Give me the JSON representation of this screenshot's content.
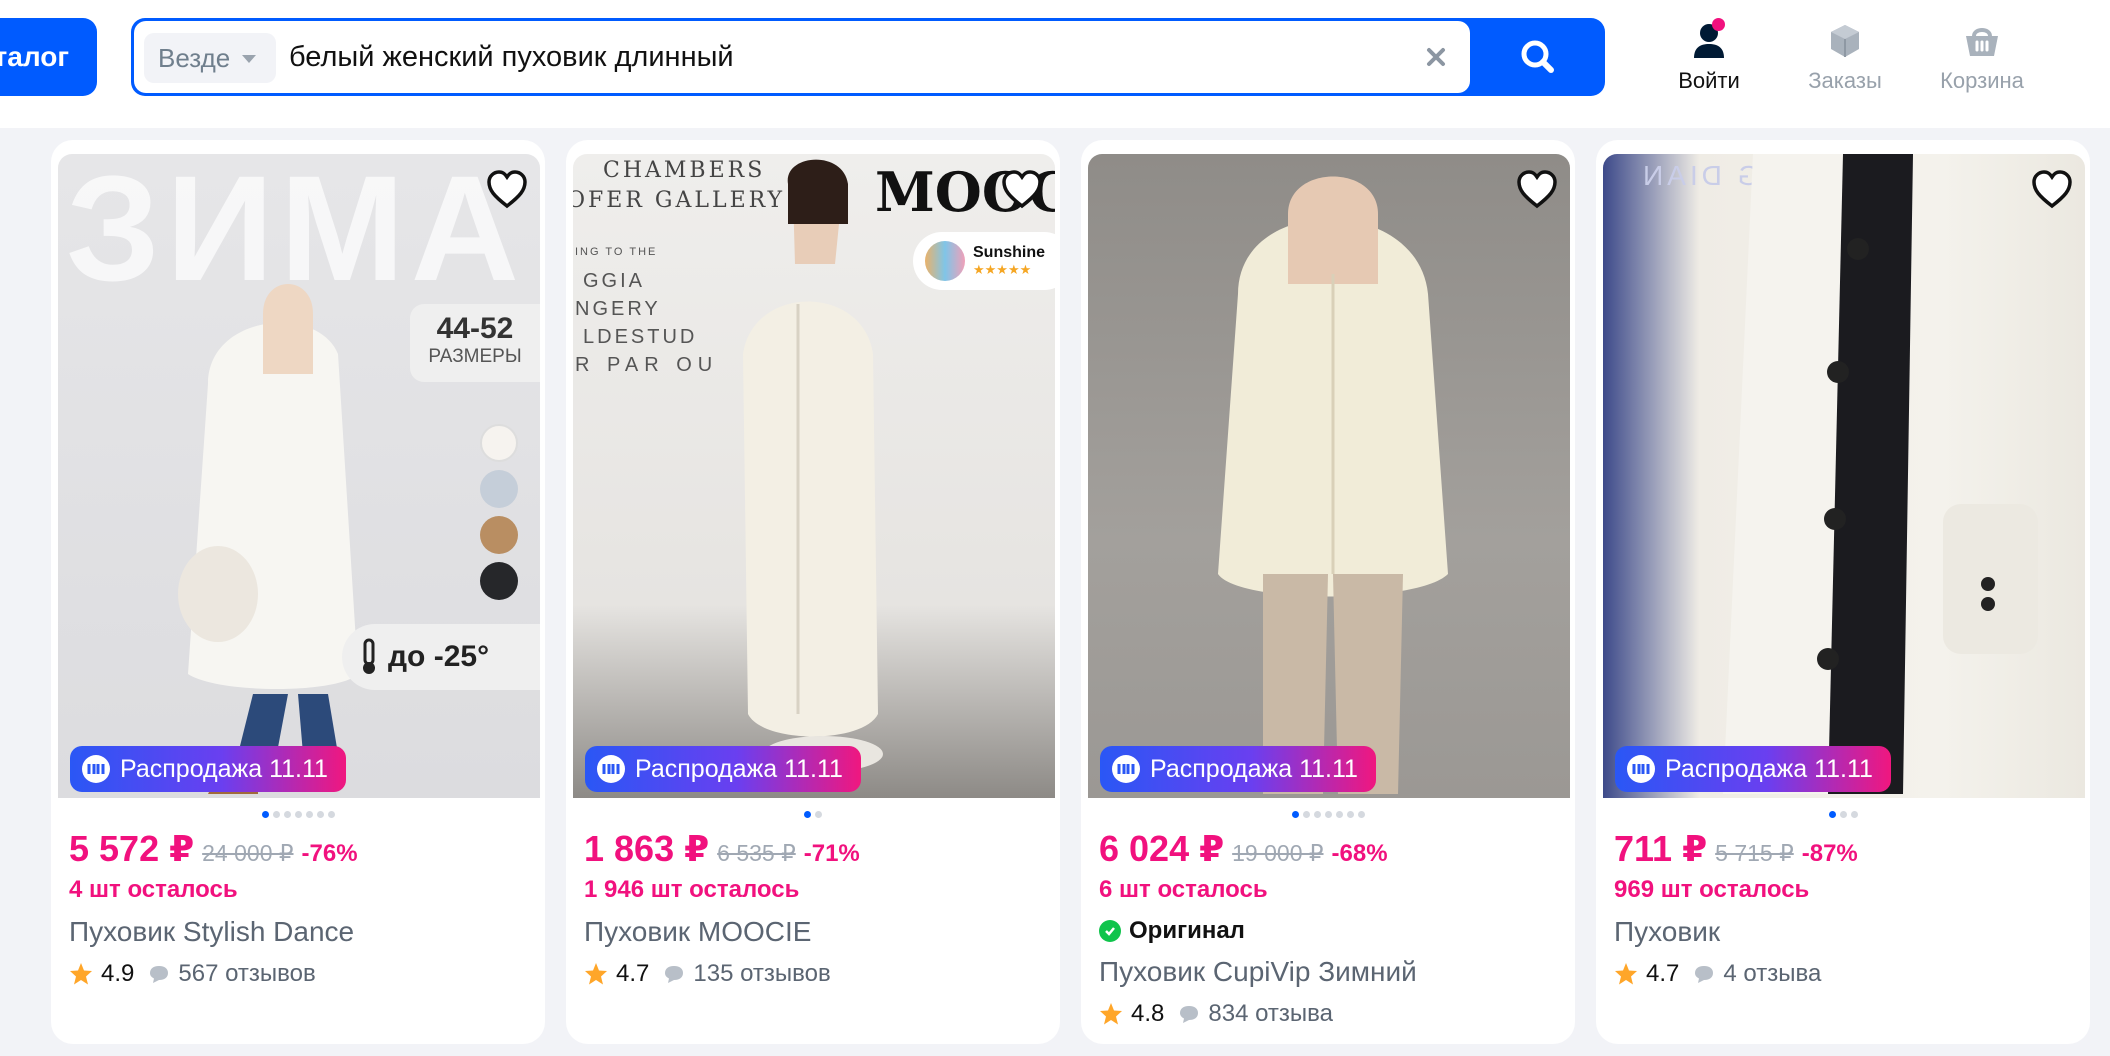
{
  "header": {
    "catalog_label": "талог",
    "search": {
      "scope": "Везде",
      "query": "белый женский пуховик длинный"
    },
    "nav": {
      "login": "Войти",
      "orders": "Заказы",
      "cart": "Корзина"
    }
  },
  "colors": {
    "accent": "#005bff",
    "price": "#f1117e",
    "badge_gradient": [
      "#2a57f5",
      "#6a3ff0",
      "#f0177f"
    ]
  },
  "products": [
    {
      "badge": "Распродажа 11.11",
      "price": "5 572 ₽",
      "old_price": "24 000 ₽",
      "discount": "-76%",
      "stock": "4 шт осталось",
      "title": "Пуховик Stylish Dance",
      "rating": "4.9",
      "reviews": "567 отзывов",
      "image_overlay": {
        "word": "ЗИМА",
        "sizes": "44-52",
        "sizes_label": "РАЗМЕРЫ",
        "temp": "до -25°"
      }
    },
    {
      "badge": "Распродажа 11.11",
      "price": "1 863 ₽",
      "old_price": "6 535 ₽",
      "discount": "-71%",
      "stock": "1 946 шт осталось",
      "title": "Пуховик MOOCIE",
      "rating": "4.7",
      "reviews": "135 отзывов",
      "image_overlay": {
        "wall_text_1": "CHAMBERS",
        "wall_text_2": "OFER GALLERY",
        "wall_text_3": "ING TO THE",
        "wall_text_4": "GGIA",
        "wall_text_5": "NGERY",
        "wall_text_6": "LDESTUD",
        "wall_text_7": "R PAR OU",
        "brand": "MOOCI",
        "sticker": "Sunshine"
      }
    },
    {
      "badge": "Распродажа 11.11",
      "price": "6 024 ₽",
      "old_price": "19 000 ₽",
      "discount": "-68%",
      "stock": "6 шт осталось",
      "original_label": "Оригинал",
      "title": "Пуховик CupiVip Зимний",
      "rating": "4.8",
      "reviews": "834 отзыва"
    },
    {
      "badge": "Распродажа 11.11",
      "price": "711 ₽",
      "old_price": "5 715 ₽",
      "discount": "-87%",
      "stock": "969 шт осталось",
      "title": "Пуховик",
      "rating": "4.7",
      "reviews": "4 отзыва",
      "image_overlay": {
        "wall_text": "ING DIAN"
      }
    }
  ]
}
